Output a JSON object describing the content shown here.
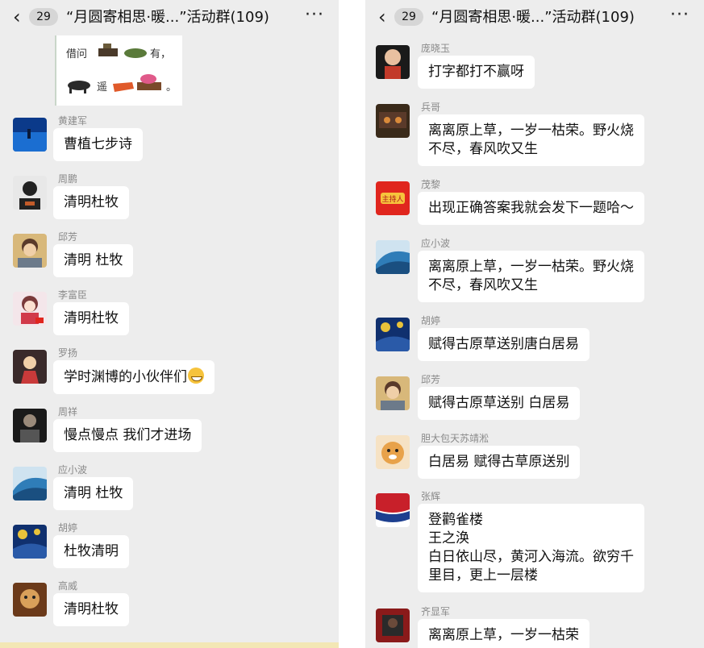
{
  "left": {
    "header": {
      "badge": "29",
      "title": "“月圆寄相思·暖...”活动群(109)",
      "more": "···"
    },
    "image_caption": {
      "line1": "借问",
      "line2_a": "有，",
      "line3": "遥",
      "line3_b": "。"
    },
    "messages": [
      {
        "name": "黄建军",
        "text": "曹植七步诗",
        "avatar_colors": [
          "#0b3a8a",
          "#1b6ed1"
        ]
      },
      {
        "name": "周鹏",
        "text": "清明杜牧",
        "avatar_colors": [
          "#222222",
          "#c25b2a"
        ]
      },
      {
        "name": "邱芳",
        "text": "清明 杜牧",
        "avatar_colors": [
          "#d8b87a",
          "#6c7a8a"
        ]
      },
      {
        "name": "李富臣",
        "text": "清明杜牧",
        "avatar_colors": [
          "#f4e6ea",
          "#d13a4a"
        ]
      },
      {
        "name": "罗扬",
        "text": "学时渊博的小伙伴们",
        "avatar_colors": [
          "#3a2a2a",
          "#c93a3a"
        ]
      },
      {
        "name": "周祥",
        "text": "慢点慢点  我们才进场",
        "avatar_colors": [
          "#1a1a1a",
          "#555555"
        ]
      },
      {
        "name": "应小波",
        "text": "清明 杜牧",
        "avatar_colors": [
          "#cfe3f0",
          "#2f7db8"
        ]
      },
      {
        "name": "胡婷",
        "text": "杜牧清明",
        "avatar_colors": [
          "#10306e",
          "#e8c23a"
        ]
      },
      {
        "name": "高威",
        "text": "清明杜牧",
        "avatar_colors": [
          "#6b3a1a",
          "#d9a05a"
        ]
      }
    ]
  },
  "right": {
    "header": {
      "badge": "29",
      "title": "“月圆寄相思·暖...”活动群(109)",
      "more": "···"
    },
    "messages": [
      {
        "name": "庞晓玉",
        "lines": [
          "打字都打不赢呀"
        ],
        "avatar_colors": [
          "#1a1a1a",
          "#c23a2a"
        ]
      },
      {
        "name": "兵哥",
        "lines": [
          "离离原上草，一岁一枯荣。野火烧",
          "不尽，春风吹又生"
        ],
        "avatar_colors": [
          "#3a2a1a",
          "#d98a3a"
        ]
      },
      {
        "name": "茂黎",
        "lines": [
          "出现正确答案我就会发下一题哈～"
        ],
        "avatar_colors": [
          "#e0261e",
          "#f6c33c"
        ],
        "avatar_text": "主持人"
      },
      {
        "name": "应小波",
        "lines": [
          "离离原上草，一岁一枯荣。野火烧",
          "不尽，春风吹又生"
        ],
        "avatar_colors": [
          "#cfe3f0",
          "#2f7db8"
        ]
      },
      {
        "name": "胡婷",
        "lines": [
          "赋得古原草送别唐白居易"
        ],
        "avatar_colors": [
          "#10306e",
          "#e8c23a"
        ]
      },
      {
        "name": "邱芳",
        "lines": [
          "赋得古原草送别 白居易"
        ],
        "avatar_colors": [
          "#d8b87a",
          "#6c7a8a"
        ]
      },
      {
        "name": "胆大包天苏靖淞",
        "lines": [
          "白居易 赋得古草原送别"
        ],
        "avatar_colors": [
          "#e8a24a",
          "#f6e2c4"
        ]
      },
      {
        "name": "张辉",
        "lines": [
          "登鹳雀楼",
          "王之涣",
          "白日依山尽，黄河入海流。欲穷千",
          "里目，更上一层楼"
        ],
        "avatar_colors": [
          "#c8202a",
          "#1d3f8f"
        ]
      },
      {
        "name": "齐显军",
        "lines": [
          "离离原上草，一岁一枯荣"
        ],
        "avatar_colors": [
          "#8a1a1a",
          "#2a2a2a"
        ]
      }
    ]
  }
}
